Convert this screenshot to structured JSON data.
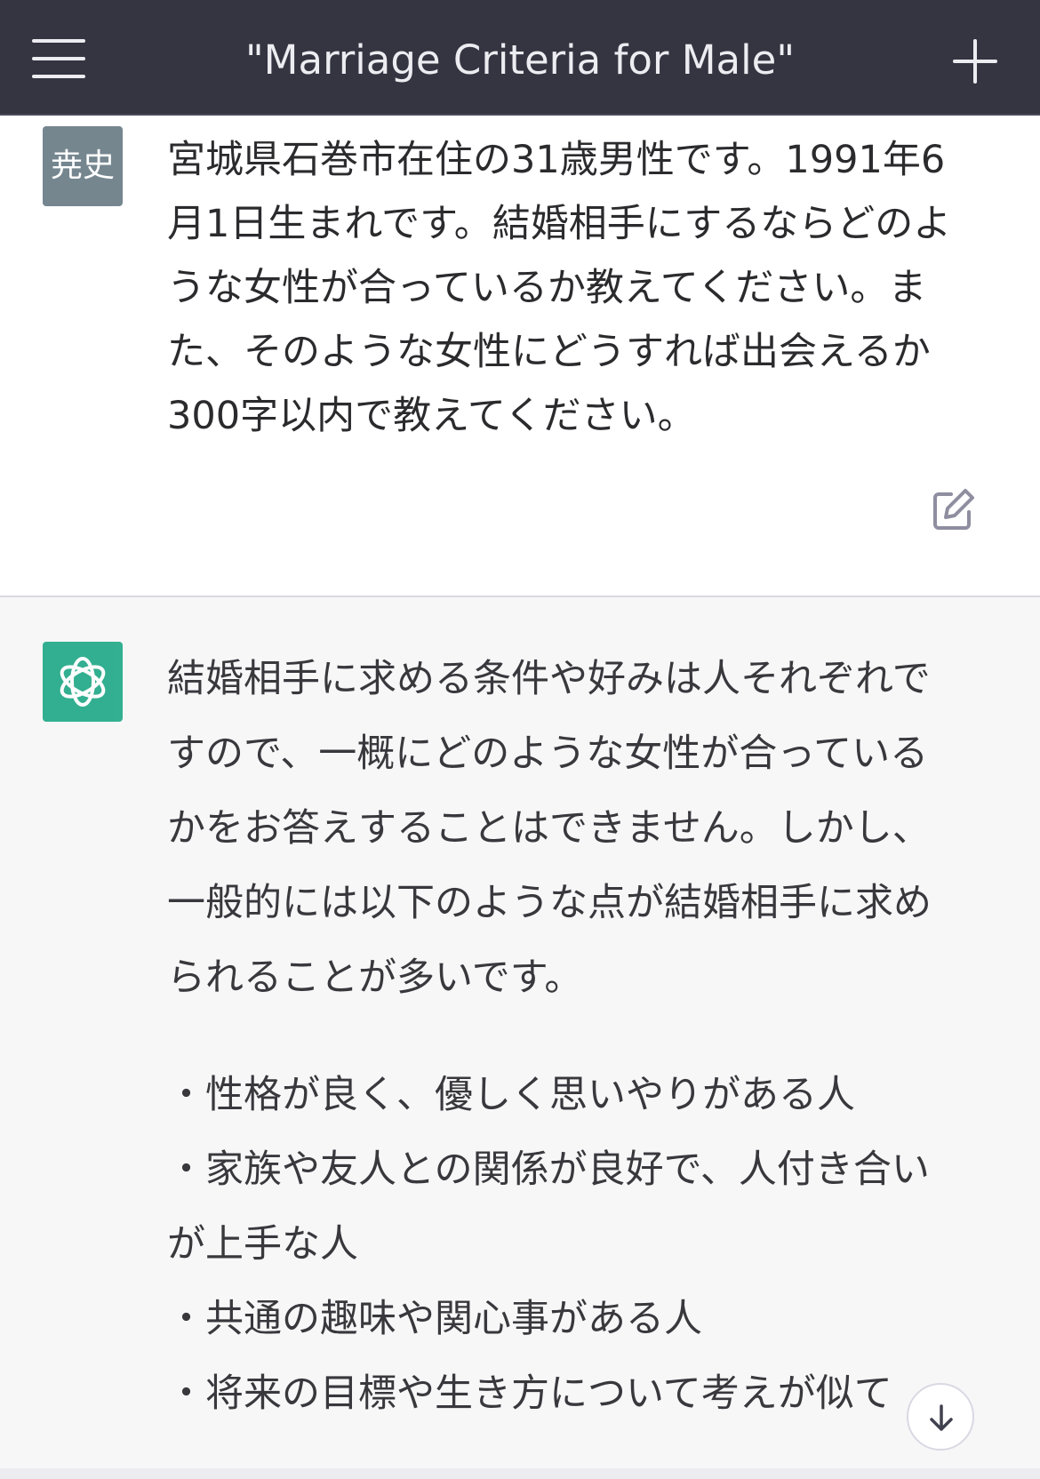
{
  "header": {
    "title": "\"Marriage Criteria for Male\"",
    "menu_icon": "hamburger-menu-icon",
    "new_chat_icon": "plus-icon"
  },
  "conversation": {
    "user": {
      "avatar_text": "尭史",
      "message_lines": [
        "宮城県石巻市在住の31歳男性です。1991年6",
        "月1日生まれです。結婚相手にするならどのよ",
        "うな女性が合っているか教えてください。ま",
        "た、そのような女性にどうすれば出会えるか",
        "300字以内で教えてください。"
      ],
      "edit_icon": "edit-icon"
    },
    "assistant": {
      "avatar_icon": "openai-logo-icon",
      "intro_lines": [
        "結婚相手に求める条件や好みは人それぞれで",
        "すので、一概にどのような女性が合っている",
        "かをお答えすることはできません。しかし、",
        "一般的には以下のような点が結婚相手に求め",
        "られることが多いです。"
      ],
      "bullet_lines": [
        "・性格が良く、優しく思いやりがある人",
        "・家族や友人との関係が良好で、人付き合い",
        "が上手な人",
        "・共通の趣味や関心事がある人",
        "・将来の目標や生き方について考えが似て"
      ]
    }
  },
  "scroll_down_icon": "arrow-down-icon",
  "colors": {
    "header_bg": "#343541",
    "user_avatar_bg": "#75868f",
    "assistant_avatar_bg": "#10a37f",
    "assistant_bg": "#f7f7f8"
  }
}
